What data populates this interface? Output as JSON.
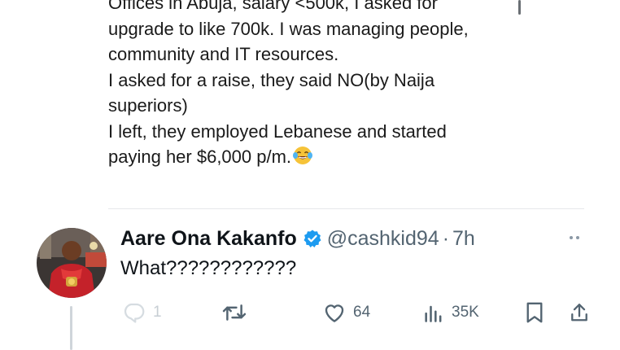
{
  "previous_tweet": {
    "lines": [
      "Offices in Abuja, salary <500k, I asked for",
      "upgrade to like 700k. I was managing people,",
      "community and IT resources.",
      "I asked for a raise, they said NO(by Naija",
      "superiors)",
      "I left, they employed Lebanese and started",
      "paying her $6,000 p/m."
    ],
    "emoji": "face-with-tears-of-joy-icon"
  },
  "reply": {
    "author_name": "Aare Ona Kakanfo",
    "handle": "@cashkid94",
    "separator": "·",
    "time": "7h",
    "text": "What????????????",
    "verified_color": "#1d9bf0"
  },
  "actions": {
    "reply_count": "1",
    "retweet_count": "",
    "like_count": "64",
    "views_count": "35K"
  }
}
